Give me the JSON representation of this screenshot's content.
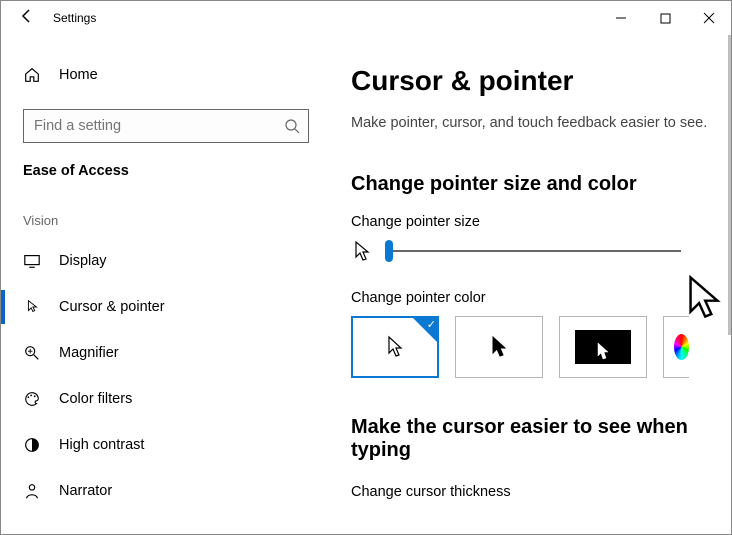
{
  "window": {
    "title": "Settings"
  },
  "sidebar": {
    "home": "Home",
    "search_placeholder": "Find a setting",
    "category": "Ease of Access",
    "group": "Vision",
    "items": [
      {
        "label": "Display"
      },
      {
        "label": "Cursor & pointer"
      },
      {
        "label": "Magnifier"
      },
      {
        "label": "Color filters"
      },
      {
        "label": "High contrast"
      },
      {
        "label": "Narrator"
      }
    ]
  },
  "main": {
    "heading": "Cursor & pointer",
    "subheading": "Make pointer, cursor, and touch feedback easier to see.",
    "section1": "Change pointer size and color",
    "label_size": "Change pointer size",
    "label_color": "Change pointer color",
    "section2": "Make the cursor easier to see when typing",
    "label_thickness": "Change cursor thickness"
  }
}
